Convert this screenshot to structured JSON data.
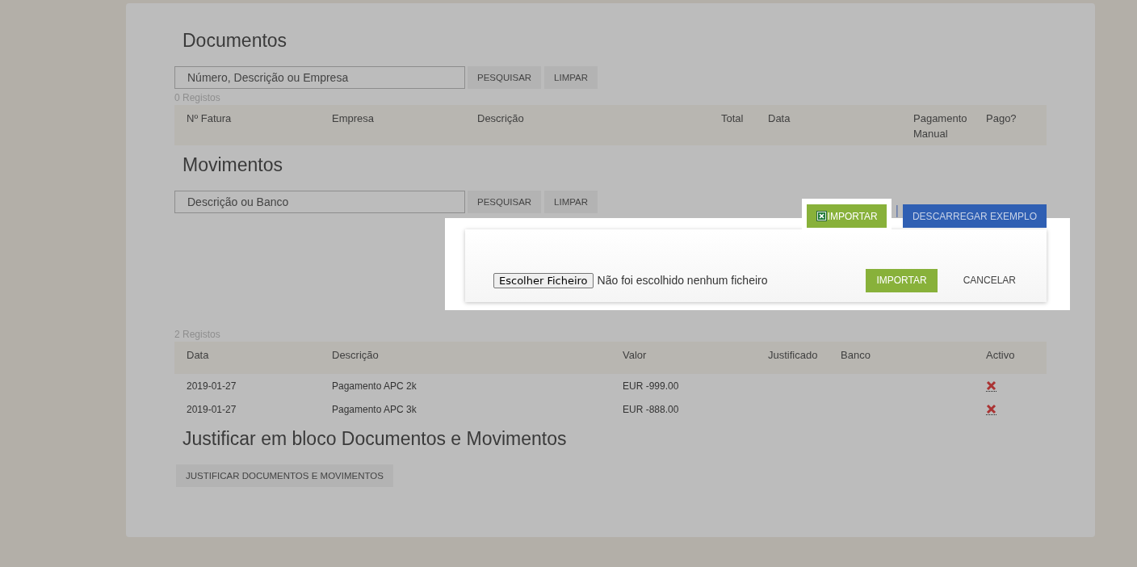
{
  "documentos": {
    "title": "Documentos",
    "search": {
      "placeholder": "Número, Descrição ou Empresa"
    },
    "buttons": [
      "PESQUISAR",
      "LIMPAR"
    ],
    "count": "0 Registos",
    "columns": [
      "Nº Fatura",
      "Empresa",
      "Descrição",
      "Total",
      "Data",
      "Pagamento Manual",
      "Pago?"
    ]
  },
  "movimentos": {
    "title": "Movimentos",
    "search": {
      "placeholder": "Descrição ou Banco"
    },
    "buttons": [
      "PESQUISAR",
      "LIMPAR"
    ],
    "import_button": "IMPORTAR",
    "separator": "|",
    "download_button": "DESCARREGAR EXEMPLO",
    "import_dialog": {
      "file_button": "Escolher Ficheiro",
      "file_status": "Não foi escolhido nenhum ficheiro",
      "confirm": "IMPORTAR",
      "cancel": "CANCELAR"
    },
    "count": "2 Registos",
    "columns": [
      "Data",
      "Descrição",
      "Valor",
      "Justificado",
      "Banco",
      "Activo"
    ],
    "rows": [
      {
        "data": "2019-01-27",
        "descricao": "Pagamento APC 2k",
        "valor": "EUR -999.00",
        "active": false
      },
      {
        "data": "2019-01-27",
        "descricao": "Pagamento APC 3k",
        "valor": "EUR -888.00",
        "active": false
      }
    ]
  },
  "bulk": {
    "title": "Justificar em bloco Documentos e Movimentos",
    "button": "JUSTIFICAR DOCUMENTOS E MOVIMENTOS"
  }
}
